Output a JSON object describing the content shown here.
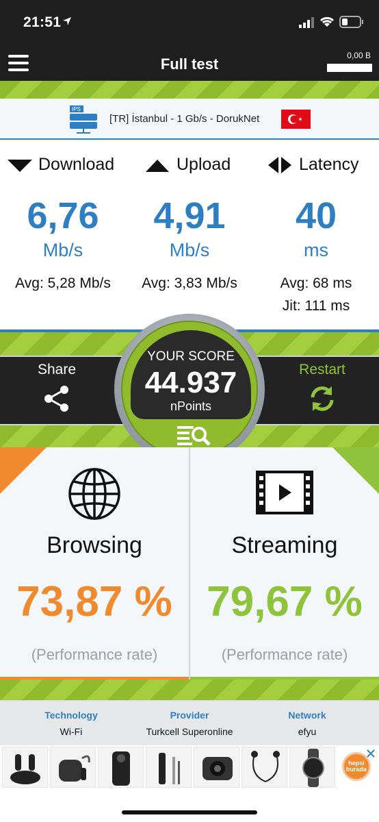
{
  "status_bar": {
    "time": "21:51"
  },
  "nav": {
    "title": "Full test",
    "data_usage": "0,00 B"
  },
  "server": {
    "label": "[TR] İstanbul - 1 Gb/s - DorukNet",
    "icon_text": "IPS"
  },
  "metrics": {
    "download": {
      "label": "Download",
      "value": "6,76",
      "unit": "Mb/s",
      "avg": "Avg: 5,28 Mb/s"
    },
    "upload": {
      "label": "Upload",
      "value": "4,91",
      "unit": "Mb/s",
      "avg": "Avg: 3,83 Mb/s"
    },
    "latency": {
      "label": "Latency",
      "value": "40",
      "unit": "ms",
      "avg": "Avg: 68 ms",
      "jitter": "Jit: 111 ms"
    }
  },
  "score": {
    "label": "YOUR SCORE",
    "value": "44.937",
    "unit": "nPoints"
  },
  "actions": {
    "share_label": "Share",
    "restart_label": "Restart"
  },
  "browsing": {
    "title": "Browsing",
    "rate": "73,87 %",
    "caption": "(Performance rate)"
  },
  "streaming": {
    "title": "Streaming",
    "rate": "79,67 %",
    "caption": "(Performance rate)"
  },
  "info": {
    "technology": {
      "label": "Technology",
      "value": "Wi-Fi"
    },
    "provider": {
      "label": "Provider",
      "value": "Turkcell Superonline"
    },
    "network": {
      "label": "Network",
      "value": "efyu"
    }
  },
  "ad": {
    "brand": "hepsi burada",
    "items": [
      "earbuds",
      "earbuds-case",
      "projector",
      "audio-adapter",
      "mini-projector",
      "wireless-earphones",
      "smartwatch"
    ]
  },
  "colors": {
    "blue": "#2d7fc1",
    "green": "#8ec33b",
    "orange": "#ef8a2f",
    "dark": "#1e1e1e"
  }
}
